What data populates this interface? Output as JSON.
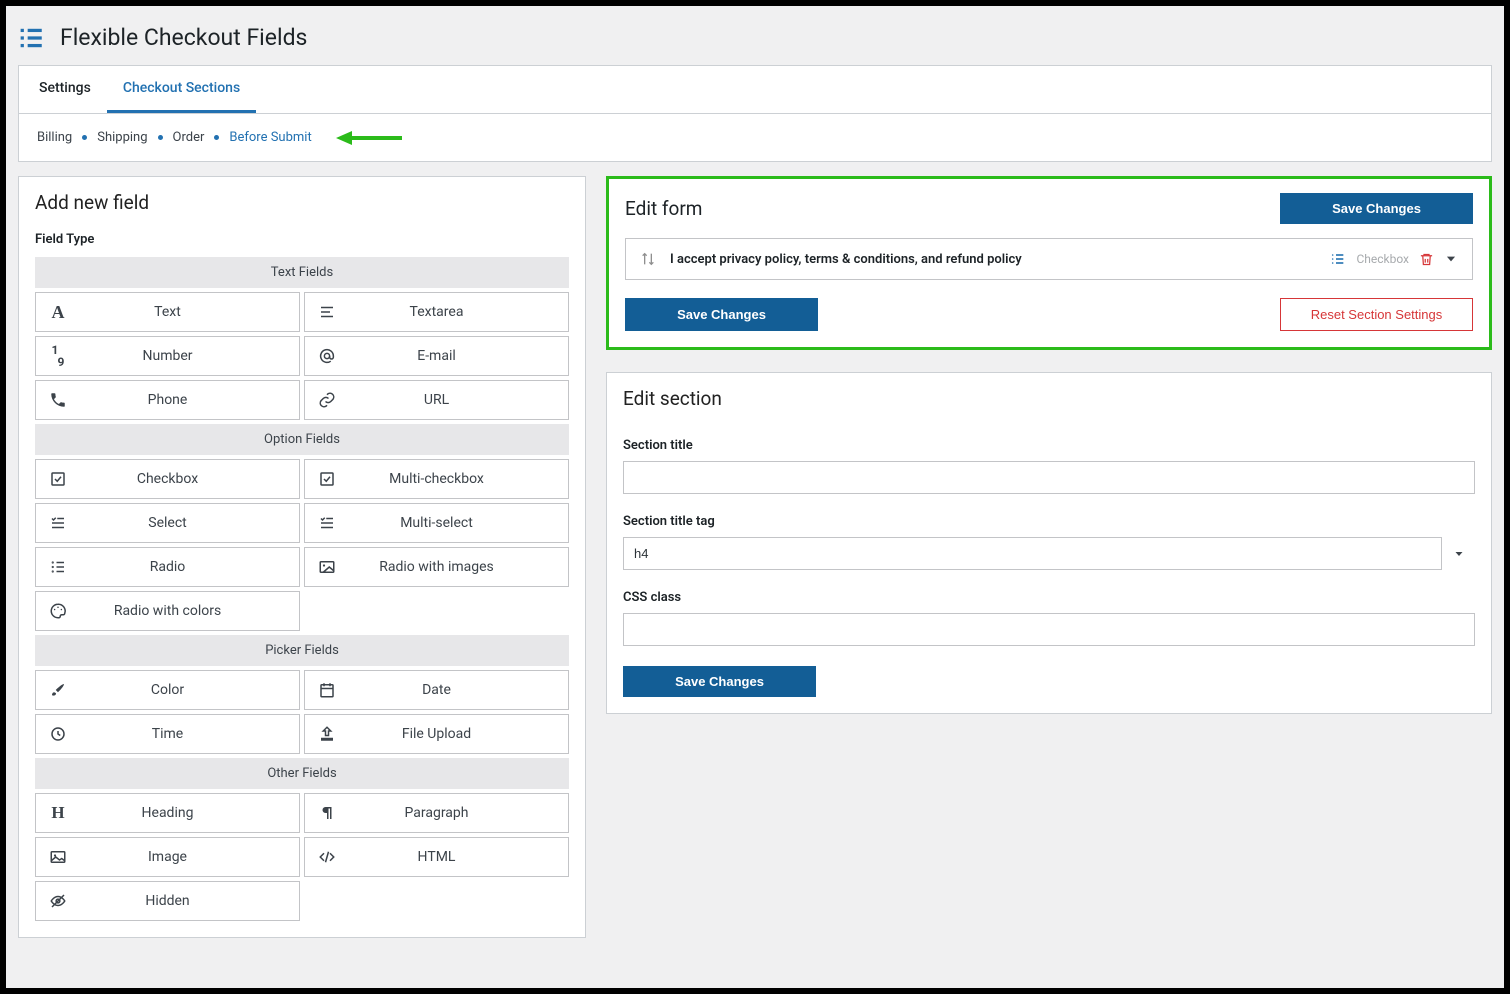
{
  "page_title": "Flexible Checkout Fields",
  "tabs": [
    "Settings",
    "Checkout Sections"
  ],
  "active_tab": 1,
  "crumbs": [
    "Billing",
    "Shipping",
    "Order",
    "Before Submit"
  ],
  "active_crumb": 3,
  "left_panel": {
    "title": "Add new field",
    "field_type_label": "Field Type",
    "groups": [
      {
        "label": "Text Fields",
        "items": [
          {
            "label": "Text",
            "icon": "A"
          },
          {
            "label": "Textarea",
            "icon": "align-left"
          },
          {
            "label": "Number",
            "icon": "subscript-19"
          },
          {
            "label": "E-mail",
            "icon": "at"
          },
          {
            "label": "Phone",
            "icon": "phone"
          },
          {
            "label": "URL",
            "icon": "link"
          }
        ]
      },
      {
        "label": "Option Fields",
        "items": [
          {
            "label": "Checkbox",
            "icon": "checkbox"
          },
          {
            "label": "Multi-checkbox",
            "icon": "checkbox"
          },
          {
            "label": "Select",
            "icon": "check-list"
          },
          {
            "label": "Multi-select",
            "icon": "check-list"
          },
          {
            "label": "Radio",
            "icon": "list"
          },
          {
            "label": "Radio with images",
            "icon": "image-box"
          },
          {
            "label": "Radio with colors",
            "icon": "palette",
            "full": true
          }
        ]
      },
      {
        "label": "Picker Fields",
        "items": [
          {
            "label": "Color",
            "icon": "brush"
          },
          {
            "label": "Date",
            "icon": "calendar"
          },
          {
            "label": "Time",
            "icon": "clock"
          },
          {
            "label": "File Upload",
            "icon": "upload"
          }
        ]
      },
      {
        "label": "Other Fields",
        "items": [
          {
            "label": "Heading",
            "icon": "H"
          },
          {
            "label": "Paragraph",
            "icon": "paragraph"
          },
          {
            "label": "Image",
            "icon": "image"
          },
          {
            "label": "HTML",
            "icon": "code"
          },
          {
            "label": "Hidden",
            "icon": "eye-off",
            "full": true
          }
        ]
      }
    ]
  },
  "edit_form": {
    "title": "Edit form",
    "save_top": "Save Changes",
    "save_bottom": "Save Changes",
    "reset": "Reset Section Settings",
    "field": {
      "label": "I accept privacy policy, terms & conditions, and refund policy",
      "type": "Checkbox"
    }
  },
  "edit_section": {
    "title": "Edit section",
    "section_title_label": "Section title",
    "section_title_value": "",
    "tag_label": "Section title tag",
    "tag_value": "h4",
    "css_label": "CSS class",
    "css_value": "",
    "save": "Save Changes"
  }
}
